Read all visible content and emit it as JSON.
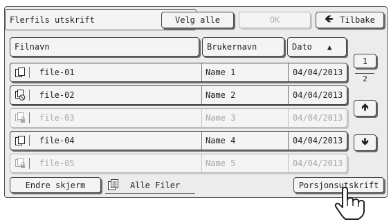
{
  "header": {
    "title": "Flerfils utskrift",
    "select_all_label": "Velg alle",
    "ok_label": "OK",
    "back_label": "Tilbake"
  },
  "columns": {
    "filename": "Filnavn",
    "username": "Brukernavn",
    "date": "Dato"
  },
  "files": [
    {
      "name": "file-01",
      "user": "Name 1",
      "date": "04/04/2013",
      "enabled": true,
      "icon": "document-stack-icon"
    },
    {
      "name": "file-02",
      "user": "Name 2",
      "date": "04/04/2013",
      "enabled": true,
      "icon": "document-blocked-icon"
    },
    {
      "name": "file-03",
      "user": "Name 3",
      "date": "04/04/2013",
      "enabled": false,
      "icon": "document-locked-icon"
    },
    {
      "name": "file-04",
      "user": "Name 4",
      "date": "04/04/2013",
      "enabled": true,
      "icon": "document-stack-icon"
    },
    {
      "name": "file-05",
      "user": "Name 5",
      "date": "04/04/2013",
      "enabled": false,
      "icon": "document-locked-icon"
    }
  ],
  "pagination": {
    "current": "1",
    "total": "2"
  },
  "footer": {
    "change_screen_label": "Endre skjerm",
    "all_files_label": "Alle Filer",
    "batch_print_label": "Porsjonsutskrift"
  },
  "colors": {
    "panel": "#ececec",
    "button": "#f4f4f4",
    "disabled_text": "#a8a8a8"
  }
}
